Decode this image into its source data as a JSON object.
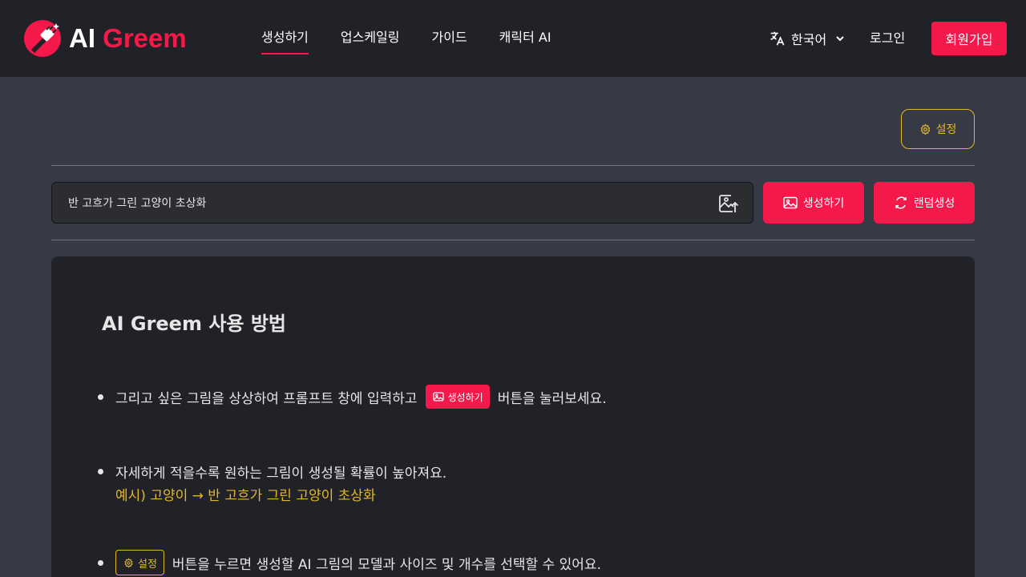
{
  "header": {
    "logo_ai": "AI",
    "logo_greem": "Greem",
    "nav": [
      {
        "label": "생성하기",
        "active": true
      },
      {
        "label": "업스케일링",
        "active": false
      },
      {
        "label": "가이드",
        "active": false
      },
      {
        "label": "캐릭터 AI",
        "active": false
      }
    ],
    "language": "한국어",
    "login": "로그인",
    "signup": "회원가입"
  },
  "toolbar": {
    "settings_label": "설정"
  },
  "prompt": {
    "value": "반 고흐가 그린 고양이 초상화",
    "generate_label": "생성하기",
    "random_label": "랜덤생성"
  },
  "guide": {
    "title": "AI Greem 사용 방법",
    "item1_before": "그리고 싶은 그림을 상상하여 프롬프트 창에 입력하고",
    "item1_button": "생성하기",
    "item1_after": "버튼을 눌러보세요.",
    "item2_text": "자세하게 적을수록 원하는 그림이 생성될 확률이 높아져요.",
    "item2_example": "예시) 고양이 → 반 고흐가 그린 고양이 초상화",
    "item3_button": "설정",
    "item3_after": "버튼을 누르면 생성할 AI 그림의 모델과 사이즈 및 개수를 선택할 수 있어요."
  },
  "colors": {
    "accent": "#f5184a",
    "gold": "#e2b72b",
    "header_bg": "#202227",
    "page_bg": "#363a45",
    "card_bg": "#202227"
  },
  "icons": [
    "logo-brush-icon",
    "translate-icon",
    "chevron-down-icon",
    "gear-icon",
    "image-upload-icon",
    "image-icon",
    "refresh-icon"
  ]
}
